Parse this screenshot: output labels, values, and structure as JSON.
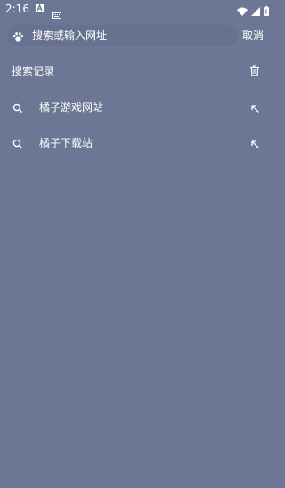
{
  "status_bar": {
    "time": "2:16",
    "icons": [
      "app-a-icon",
      "keyboard-icon",
      "wifi-icon",
      "signal-icon",
      "battery-icon"
    ]
  },
  "search": {
    "placeholder": "搜索或输入网址",
    "cancel_label": "取消",
    "engine_icon": "paw-icon"
  },
  "history": {
    "title": "搜索记录",
    "clear_icon": "trash-icon",
    "items": [
      {
        "label": "橘子游戏网站",
        "icon": "search-icon",
        "action_icon": "arrow-up-left-icon"
      },
      {
        "label": "橘子下载站",
        "icon": "search-icon",
        "action_icon": "arrow-up-left-icon"
      }
    ]
  },
  "colors": {
    "background": "#6b7794",
    "search_pill": "#66728f",
    "text": "#ffffff"
  }
}
